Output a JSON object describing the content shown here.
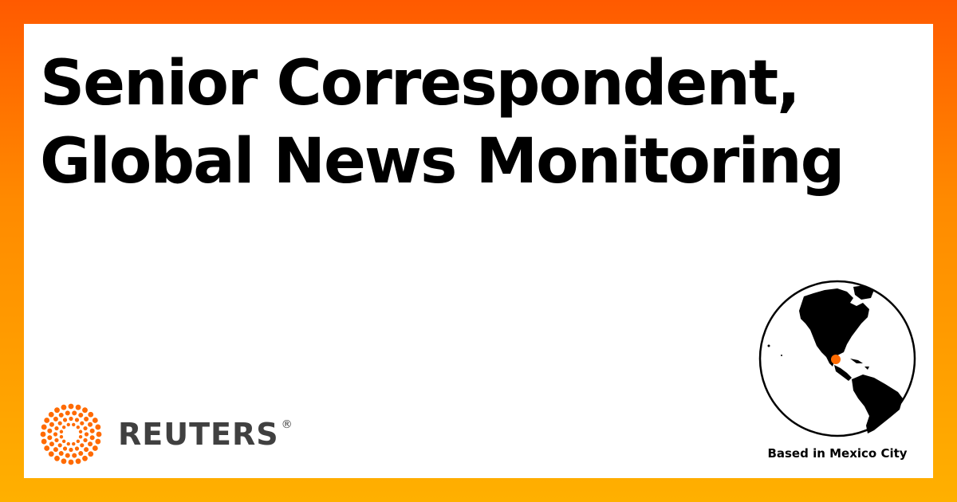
{
  "headline": {
    "line1": "Senior Correspondent,",
    "line2": "Global News Monitoring"
  },
  "brand": {
    "name": "REUTERS",
    "registered": "®",
    "logo_color": "#ff6a00",
    "text_color": "#404040"
  },
  "location": {
    "label": "Based in Mexico City",
    "marker_color": "#ff6a00"
  },
  "colors": {
    "frame_top": "#ff5a00",
    "frame_bottom": "#ffb000",
    "card": "#ffffff"
  }
}
